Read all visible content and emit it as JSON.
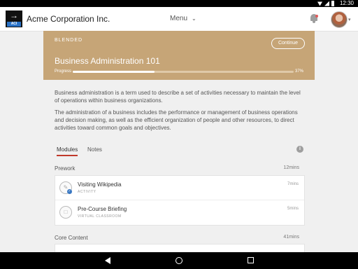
{
  "status_bar": {
    "time": "12:30"
  },
  "app_bar": {
    "logo_text": "ACI",
    "title": "Acme Corporation Inc.",
    "menu_label": "Menu"
  },
  "course": {
    "type": "BLENDED",
    "continue_label": "Continue",
    "title": "Business Administration 101",
    "progress_label": "Progress",
    "progress_value": 37,
    "progress_text": "37%"
  },
  "description": [
    "Business administration is a term used to describe a set of activities necessary to maintain the level of operations within business organizations.",
    "The administration of a business includes the performance or management of business operations and decision making, as well as the efficient organization of people and other resources, to direct activities toward common goals and objectives."
  ],
  "tabs": [
    {
      "label": "Modules",
      "active": true
    },
    {
      "label": "Notes",
      "active": false
    }
  ],
  "sections": [
    {
      "title": "Prework",
      "duration": "12mins",
      "items": [
        {
          "title": "Visiting Wikipedia",
          "type": "ACTIVITY",
          "duration": "7mins",
          "icon": "activity-icon",
          "completed": true
        },
        {
          "title": "Pre-Course Briefing",
          "type": "VIRTUAL CLASSROOM",
          "duration": "5mins",
          "icon": "classroom-icon",
          "completed": false
        }
      ]
    },
    {
      "title": "Core Content",
      "duration": "41mins"
    }
  ],
  "colors": {
    "hero": "#c6a577",
    "tab_underline": "#c0392b",
    "check": "#3a78c2"
  }
}
